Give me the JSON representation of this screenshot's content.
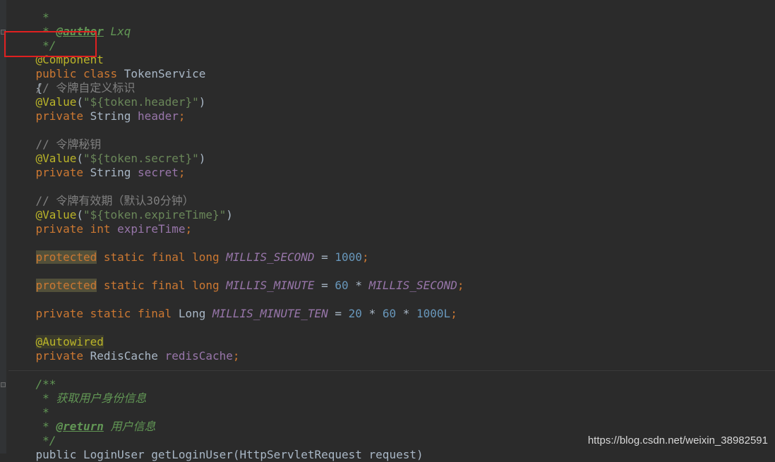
{
  "code": {
    "l1": {
      "star": " *"
    },
    "l2": {
      "star": " * ",
      "tag": "@author",
      "rest": " Lxq"
    },
    "l3": {
      "close": " */"
    },
    "l4": {
      "annotation": "@Component"
    },
    "l5": {
      "kw1": "public",
      "kw2": "class",
      "name": "TokenService"
    },
    "l6": {
      "brace": "{"
    },
    "l7": {
      "comment": "// 令牌自定义标识"
    },
    "l8": {
      "ann": "@Value",
      "open": "(",
      "str": "\"${token.header}\"",
      "close": ")"
    },
    "l9": {
      "kw": "private",
      "type": "String",
      "field": "header",
      "semi": ";"
    },
    "l11": {
      "comment": "// 令牌秘钥"
    },
    "l12": {
      "ann": "@Value",
      "open": "(",
      "str": "\"${token.secret}\"",
      "close": ")"
    },
    "l13": {
      "kw": "private",
      "type": "String",
      "field": "secret",
      "semi": ";"
    },
    "l15": {
      "comment": "// 令牌有效期（默认30分钟）"
    },
    "l16": {
      "ann": "@Value",
      "open": "(",
      "str": "\"${token.expireTime}\"",
      "close": ")"
    },
    "l17": {
      "kw": "private",
      "type": "int",
      "field": "expireTime",
      "semi": ";"
    },
    "l19": {
      "prot": "protected",
      "mods": "static final long",
      "const": "MILLIS_SECOND",
      "eq": " = ",
      "num": "1000",
      "semi": ";"
    },
    "l21": {
      "prot": "protected",
      "mods": "static final long",
      "const": "MILLIS_MINUTE",
      "eq": " = ",
      "num": "60",
      "op": " * ",
      "ref": "MILLIS_SECOND",
      "semi": ";"
    },
    "l23": {
      "mods": "private static final",
      "type": "Long",
      "const": "MILLIS_MINUTE_TEN",
      "eq": " = ",
      "n1": "20",
      "op1": " * ",
      "n2": "60",
      "op2": " * ",
      "n3": "1000L",
      "semi": ";"
    },
    "l25": {
      "ann": "@Autowired"
    },
    "l26": {
      "kw": "private",
      "type": "RedisCache",
      "field": "redisCache",
      "semi": ";"
    },
    "l28": {
      "open": "/**"
    },
    "l29": {
      "text": " * 获取用户身份信息"
    },
    "l30": {
      "text": " *"
    },
    "l31": {
      "star": " * ",
      "tag": "@return",
      "rest": " 用户信息"
    },
    "l32": {
      "close": " */"
    },
    "l33": {
      "text": "public LoginUser getLoginUser(HttpServletRequest request)"
    }
  },
  "watermark": "https://blog.csdn.net/weixin_38982591"
}
